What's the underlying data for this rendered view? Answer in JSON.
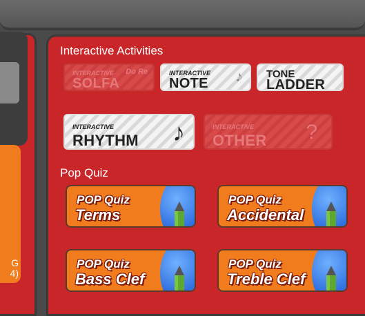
{
  "left_panel": {
    "text_line1": "G",
    "text_line2": "4)"
  },
  "activities": {
    "heading": "Interactive Activities",
    "buttons": [
      {
        "small": "INTERACTIVE",
        "big": "SOLFA",
        "deco": "Do Re",
        "enabled": false
      },
      {
        "small": "INTERACTIVE",
        "big": "NOTE",
        "deco": "♪",
        "enabled": true
      },
      {
        "small": "TONE",
        "big": "LADDER",
        "deco": "",
        "enabled": true
      },
      {
        "small": "INTERACTIVE",
        "big": "RHYTHM",
        "deco": "♪",
        "enabled": true
      },
      {
        "small": "INTERACTIVE",
        "big": "OTHER",
        "deco": "?",
        "enabled": false
      }
    ]
  },
  "pop_quiz": {
    "heading": "Pop Quiz",
    "items": [
      {
        "top": "POP Quiz",
        "sub": "Terms"
      },
      {
        "top": "POP Quiz",
        "sub": "Accidental"
      },
      {
        "top": "POP Quiz",
        "sub": "Bass Clef"
      },
      {
        "top": "POP Quiz",
        "sub": "Treble Clef"
      }
    ]
  }
}
